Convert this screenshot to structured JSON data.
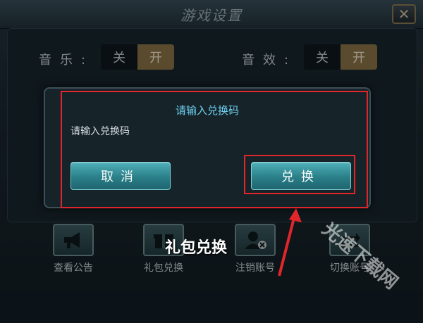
{
  "window": {
    "title": "游戏设置",
    "close_glyph": "✕"
  },
  "settings": {
    "music_label": "音乐:",
    "sfx_label": "音效:",
    "off_label": "关",
    "on_label": "开",
    "music_state": "开",
    "sfx_state": "开"
  },
  "dialog": {
    "title": "请输入兑换码",
    "input_placeholder": "请输入兑换码",
    "cancel_label": "取消",
    "confirm_label": "兑换"
  },
  "bottom_bar": {
    "items": [
      {
        "label": "查看公告",
        "icon": "megaphone-icon"
      },
      {
        "label": "礼包兑换",
        "icon": "gift-icon"
      },
      {
        "label": "注销账号",
        "icon": "user-remove-icon"
      },
      {
        "label": "切换账号",
        "icon": "swap-icon"
      }
    ]
  },
  "annotation": {
    "text": "礼包兑换",
    "color": "#e0262b"
  },
  "watermark": {
    "text": "光速下载网"
  }
}
